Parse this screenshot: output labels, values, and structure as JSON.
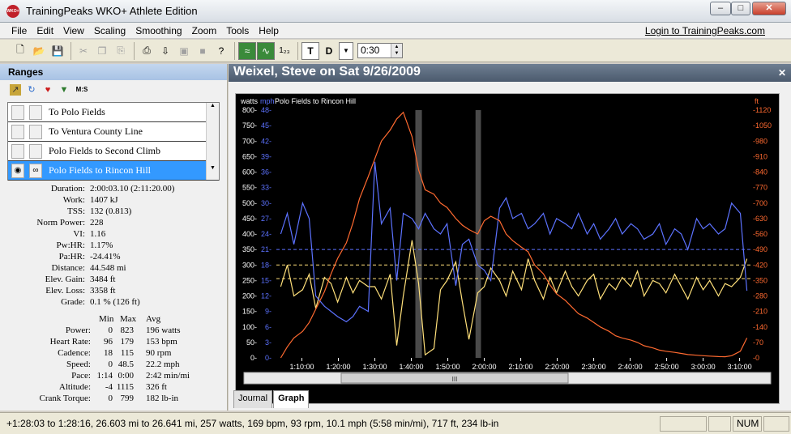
{
  "window": {
    "title": "TrainingPeaks WKO+ Athlete Edition",
    "logo_text": "WKO+",
    "min": "–",
    "max": "□",
    "close": "✕"
  },
  "menu": [
    "File",
    "Edit",
    "View",
    "Scaling",
    "Smoothing",
    "Zoom",
    "Tools",
    "Help"
  ],
  "login_link": "Login to TrainingPeaks.com",
  "toolbar": {
    "time_value": "0:30",
    "t_label": "T",
    "d_label": "D",
    "count_label": "1₂₃"
  },
  "ranges": {
    "header": "Ranges",
    "ms_label": "M:S",
    "items": [
      {
        "label": "To Polo Fields",
        "selected": false
      },
      {
        "label": "To Ventura County Line",
        "selected": false
      },
      {
        "label": "Polo Fields to Second Climb",
        "selected": false
      },
      {
        "label": "Polo Fields to Rincon Hill",
        "selected": true
      }
    ]
  },
  "summary": [
    {
      "label": "Duration:",
      "value": "2:00:03.10 (2:11:20.00)"
    },
    {
      "label": "Work:",
      "value": "1407 kJ"
    },
    {
      "label": "TSS:",
      "value": "132 (0.813)"
    },
    {
      "label": "Norm Power:",
      "value": "228"
    },
    {
      "label": "VI:",
      "value": "1.16"
    },
    {
      "label": "Pw:HR:",
      "value": "1.17%"
    },
    {
      "label": "Pa:HR:",
      "value": "-24.41%"
    },
    {
      "label": "Distance:",
      "value": "44.548 mi"
    },
    {
      "label": "Elev. Gain:",
      "value": "3484 ft"
    },
    {
      "label": "Elev. Loss:",
      "value": "3358 ft"
    },
    {
      "label": "Grade:",
      "value": "0.1 %  (126 ft)"
    }
  ],
  "stats_table": {
    "headers": [
      "Min",
      "Max",
      "Avg"
    ],
    "rows": [
      {
        "label": "Power:",
        "min": "0",
        "max": "823",
        "avg": "196 watts"
      },
      {
        "label": "Heart Rate:",
        "min": "96",
        "max": "179",
        "avg": "153 bpm"
      },
      {
        "label": "Cadence:",
        "min": "18",
        "max": "115",
        "avg": "90 rpm"
      },
      {
        "label": "Speed:",
        "min": "0",
        "max": "48.5",
        "avg": "22.2 mph"
      },
      {
        "label": "Pace:",
        "min": "1:14",
        "max": "0:00",
        "avg": "2:42 min/mi"
      },
      {
        "label": "Altitude:",
        "min": "-4",
        "max": "1115",
        "avg": "326 ft"
      },
      {
        "label": "Crank Torque:",
        "min": "0",
        "max": "799",
        "avg": "182 lb-in"
      }
    ]
  },
  "graph": {
    "title": "Weixel, Steve on Sat 9/26/2009",
    "close": "✕",
    "range_label": "Polo Fields to Rincon Hill",
    "scroll_grip": "III"
  },
  "tabs": [
    {
      "label": "Journal",
      "active": false
    },
    {
      "label": "Graph",
      "active": true
    }
  ],
  "status": {
    "text": "+1:28:03 to 1:28:16, 26.603 mi to 26.641 mi, 257 watts, 169 bpm, 93 rpm, 10.1 mph (5:58 min/mi), 717 ft, 234 lb-in",
    "num": "NUM"
  },
  "colors": {
    "power": "#ffe07a",
    "speed": "#5c72ff",
    "altitude": "#ff6a30",
    "plot_bg": "#000000",
    "gap_bg": "#4a4a4a",
    "axis_watts": "#ffffff",
    "axis_mph": "#5c72ff",
    "axis_ft": "#ff6a30"
  },
  "chart_data": {
    "type": "line",
    "title": "Polo Fields to Rincon Hill",
    "x_ticks": [
      "1:10:00",
      "1:20:00",
      "1:30:00",
      "1:40:00",
      "1:50:00",
      "2:00:00",
      "2:10:00",
      "2:20:00",
      "2:30:00",
      "2:40:00",
      "2:50:00",
      "3:00:00",
      "3:10:00"
    ],
    "axes": {
      "watts": {
        "label": "watts",
        "ylim": [
          0,
          800
        ],
        "ticks": [
          0,
          50,
          100,
          150,
          200,
          250,
          300,
          350,
          400,
          450,
          500,
          550,
          600,
          650,
          700,
          750,
          800
        ]
      },
      "mph": {
        "label": "mph",
        "ylim": [
          0,
          48
        ],
        "ticks": [
          0,
          3,
          6,
          9,
          12,
          15,
          18,
          21,
          24,
          27,
          30,
          33,
          36,
          39,
          42,
          45,
          48
        ]
      },
      "ft": {
        "label": "ft",
        "ylim": [
          0,
          1120
        ],
        "ticks": [
          0,
          70,
          140,
          210,
          280,
          350,
          420,
          490,
          560,
          630,
          700,
          770,
          840,
          910,
          980,
          1050,
          1120
        ]
      }
    },
    "reference_lines": {
      "watts": [
        256,
        300
      ],
      "mph": [
        21
      ]
    },
    "series": [
      {
        "name": "Power",
        "unit": "watts",
        "x": [
          1.07,
          1.1,
          1.13,
          1.17,
          1.2,
          1.23,
          1.27,
          1.3,
          1.33,
          1.37,
          1.4,
          1.43,
          1.47,
          1.5,
          1.53,
          1.57,
          1.6,
          1.63,
          1.67,
          1.7,
          1.73,
          1.77,
          1.8,
          1.83,
          1.87,
          1.9,
          1.93,
          1.97,
          2.0,
          2.03,
          2.07,
          2.1,
          2.13,
          2.17,
          2.2,
          2.23,
          2.27,
          2.3,
          2.33,
          2.37,
          2.4,
          2.43,
          2.47,
          2.5,
          2.53,
          2.57,
          2.6,
          2.63,
          2.67,
          2.7,
          2.73,
          2.77,
          2.8,
          2.83,
          2.87,
          2.9,
          2.93,
          2.97,
          3.0,
          3.03,
          3.07,
          3.1,
          3.13,
          3.17,
          3.2
        ],
        "values": [
          230,
          300,
          200,
          220,
          270,
          160,
          260,
          240,
          180,
          260,
          210,
          250,
          230,
          230,
          190,
          270,
          40,
          200,
          380,
          240,
          10,
          30,
          220,
          250,
          310,
          180,
          60,
          210,
          230,
          290,
          250,
          200,
          280,
          220,
          320,
          250,
          190,
          260,
          210,
          280,
          230,
          200,
          250,
          270,
          190,
          240,
          220,
          260,
          230,
          280,
          200,
          250,
          240,
          210,
          270,
          230,
          190,
          260,
          220,
          250,
          200,
          240,
          230,
          260,
          320
        ]
      },
      {
        "name": "Speed",
        "unit": "mph",
        "x": [
          1.07,
          1.1,
          1.13,
          1.17,
          1.2,
          1.23,
          1.27,
          1.3,
          1.33,
          1.37,
          1.4,
          1.43,
          1.47,
          1.5,
          1.53,
          1.57,
          1.6,
          1.63,
          1.67,
          1.7,
          1.73,
          1.77,
          1.8,
          1.83,
          1.87,
          1.9,
          1.93,
          1.97,
          2.0,
          2.03,
          2.07,
          2.1,
          2.13,
          2.17,
          2.2,
          2.23,
          2.27,
          2.3,
          2.33,
          2.37,
          2.4,
          2.43,
          2.47,
          2.5,
          2.53,
          2.57,
          2.6,
          2.63,
          2.67,
          2.7,
          2.73,
          2.77,
          2.8,
          2.83,
          2.87,
          2.9,
          2.93,
          2.97,
          3.0,
          3.03,
          3.07,
          3.1,
          3.13,
          3.17,
          3.2
        ],
        "values": [
          24,
          28,
          22,
          30,
          27,
          12,
          10,
          9,
          8,
          7,
          8,
          10,
          9,
          38,
          26,
          29,
          15,
          28,
          27,
          25,
          28,
          25,
          24,
          26,
          14,
          22,
          23,
          18,
          17,
          15,
          29,
          31,
          27,
          28,
          25,
          26,
          28,
          24,
          27,
          26,
          25,
          28,
          24,
          26,
          23,
          25,
          27,
          24,
          26,
          25,
          23,
          24,
          26,
          22,
          25,
          24,
          21,
          27,
          25,
          26,
          24,
          25,
          30,
          28,
          13
        ]
      },
      {
        "name": "Altitude",
        "unit": "ft",
        "x": [
          1.07,
          1.1,
          1.13,
          1.17,
          1.2,
          1.23,
          1.27,
          1.3,
          1.33,
          1.37,
          1.4,
          1.43,
          1.47,
          1.5,
          1.53,
          1.57,
          1.6,
          1.63,
          1.67,
          1.7,
          1.73,
          1.77,
          1.8,
          1.83,
          1.87,
          1.9,
          1.93,
          1.97,
          2.0,
          2.03,
          2.07,
          2.1,
          2.13,
          2.17,
          2.2,
          2.23,
          2.27,
          2.3,
          2.33,
          2.37,
          2.4,
          2.43,
          2.47,
          2.5,
          2.53,
          2.57,
          2.6,
          2.63,
          2.67,
          2.7,
          2.73,
          2.77,
          2.8,
          2.83,
          2.87,
          2.9,
          2.93,
          2.97,
          3.0,
          3.03,
          3.07,
          3.1,
          3.13,
          3.17,
          3.2
        ],
        "values": [
          0,
          50,
          90,
          120,
          160,
          220,
          300,
          380,
          450,
          520,
          610,
          720,
          820,
          900,
          980,
          1030,
          1080,
          1110,
          1000,
          850,
          760,
          740,
          700,
          680,
          630,
          600,
          580,
          560,
          620,
          640,
          620,
          560,
          530,
          500,
          480,
          420,
          380,
          330,
          290,
          260,
          230,
          200,
          180,
          160,
          140,
          120,
          100,
          90,
          80,
          70,
          55,
          45,
          35,
          30,
          25,
          20,
          15,
          12,
          10,
          8,
          6,
          5,
          10,
          30,
          90
        ]
      }
    ],
    "gaps": [
      [
        1.685,
        1.715
      ],
      [
        1.96,
        1.985
      ]
    ]
  }
}
